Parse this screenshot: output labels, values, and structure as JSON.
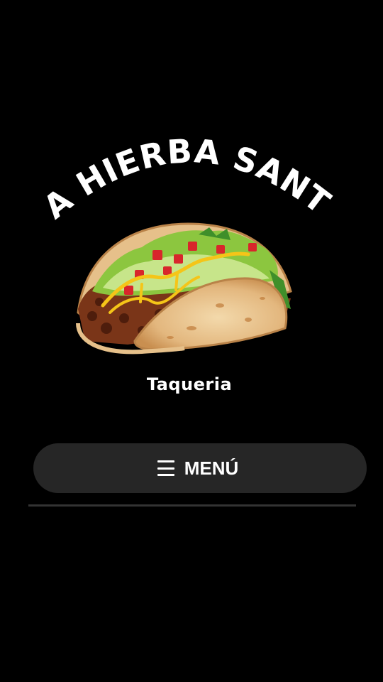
{
  "brand": {
    "name": "LA HIERBA SANTA",
    "tagline": "Taqueria"
  },
  "nav": {
    "menu_label": "MENÚ",
    "menu_icon": "hamburger-icon"
  },
  "colors": {
    "background": "#000000",
    "button_bg": "#262626",
    "divider": "#333333",
    "text": "#ffffff"
  }
}
